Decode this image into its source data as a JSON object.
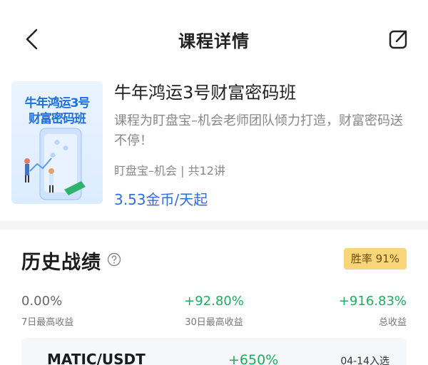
{
  "nav": {
    "title": "课程详情",
    "back_icon": "chevron-left-icon",
    "share_icon": "share-icon"
  },
  "course": {
    "cover_line1": "牛年鸿运3号",
    "cover_line2": "财富密码班",
    "title": "牛年鸿运3号财富密码班",
    "description": "课程为盯盘宝–机会老师团队倾力打造，财富密码送不停！",
    "meta": "盯盘宝–机会 | 共12讲",
    "price": "3.53金币/天起"
  },
  "history": {
    "title": "历史战绩",
    "help_icon": "question-circle-icon",
    "winrate": "胜率  91%",
    "stats": [
      {
        "value": "0.00%",
        "label": "7日最高收益"
      },
      {
        "value": "+92.80%",
        "label": "30日最高收益"
      },
      {
        "value": "+916.83%",
        "label": "总收益"
      }
    ],
    "record": {
      "pair": "MATIC/USDT",
      "gain": "+650%",
      "date": "04-14入选"
    }
  },
  "colors": {
    "accent_blue": "#2f6de1",
    "gain_green": "#1cae5f",
    "badge_bg": "#f9d57a"
  }
}
